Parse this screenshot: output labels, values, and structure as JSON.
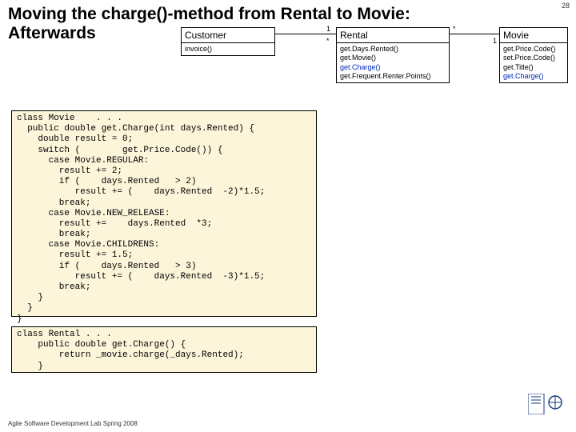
{
  "page_number": "28",
  "title_line1": "Moving the charge()-method from Rental to Movie:",
  "title_line2": "Afterwards",
  "uml": {
    "customer": {
      "name": "Customer",
      "methods": "invoice()"
    },
    "rental": {
      "name": "Rental",
      "m1": "get.Days.Rented()",
      "m2": "get.Movie()",
      "m3": "get.Charge()",
      "m4": "get.Frequent.Renter.Points()"
    },
    "movie": {
      "name": "Movie",
      "m1": "get.Price.Code()",
      "m2": "set.Price.Code()",
      "m3": "get.Title()",
      "m4": "get.Charge()"
    },
    "mult": {
      "c_r_left": "1",
      "c_r_right": "*",
      "r_m_left": "*",
      "r_m_right": "1"
    }
  },
  "code_movie": "class Movie    . . .\n  public double get.Charge(int days.Rented) {\n    double result = 0;\n    switch (        get.Price.Code()) {\n      case Movie.REGULAR:\n        result += 2;\n        if (    days.Rented   > 2)\n           result += (    days.Rented  -2)*1.5;\n        break;\n      case Movie.NEW_RELEASE:\n        result +=    days.Rented  *3;\n        break;\n      case Movie.CHILDRENS:\n        result += 1.5;\n        if (    days.Rented   > 3)\n           result += (    days.Rented  -3)*1.5;\n        break;\n    }\n  }\n}",
  "code_rental": "class Rental . . .\n    public double get.Charge() {\n        return _movie.charge(_days.Rented);\n    }",
  "footer": "Agile Software Development Lab Spring 2008"
}
